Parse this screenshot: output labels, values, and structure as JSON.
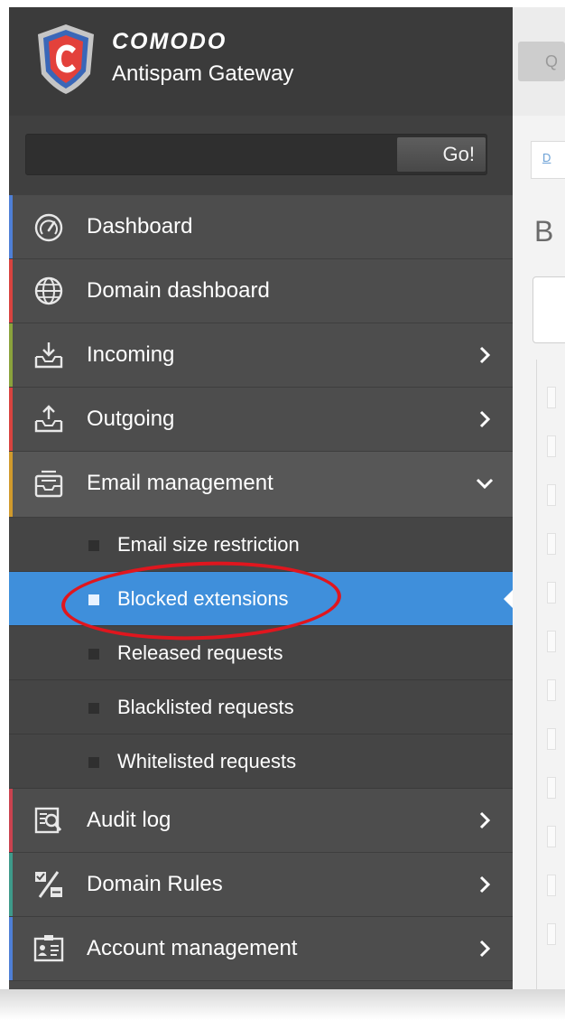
{
  "brand": {
    "name": "COMODO",
    "product": "Antispam Gateway"
  },
  "search": {
    "value": "",
    "button_label": "Go!"
  },
  "nav": {
    "dashboard": {
      "label": "Dashboard",
      "accent": "#4e7fd6"
    },
    "domain_dashboard": {
      "label": "Domain dashboard",
      "accent": "#d8433f"
    },
    "incoming": {
      "label": "Incoming",
      "accent": "#8aa23c"
    },
    "outgoing": {
      "label": "Outgoing",
      "accent": "#d8433f"
    },
    "email_management": {
      "label": "Email management",
      "accent": "#d09a2c",
      "expanded": true,
      "items": [
        {
          "label": "Email size restriction",
          "active": false
        },
        {
          "label": "Blocked extensions",
          "active": true
        },
        {
          "label": "Released requests",
          "active": false
        },
        {
          "label": "Blacklisted requests",
          "active": false
        },
        {
          "label": "Whitelisted requests",
          "active": false
        }
      ]
    },
    "audit_log": {
      "label": "Audit log",
      "accent": "#c9424f"
    },
    "domain_rules": {
      "label": "Domain Rules",
      "accent": "#3e9a8a"
    },
    "account_management": {
      "label": "Account management",
      "accent": "#4e7fd6"
    }
  },
  "main": {
    "top_button_text": "Q",
    "breadcrumb": "D",
    "page_title_letter": "B"
  },
  "icons": {
    "logo": "comodo-shield-logo",
    "dashboard": "gauge-icon",
    "domain_dashboard": "globe-icon",
    "incoming": "inbox-download-icon",
    "outgoing": "outbox-upload-icon",
    "email_management": "mail-tray-icon",
    "audit_log": "log-search-icon",
    "domain_rules": "rules-percent-icon",
    "account_management": "id-card-icon"
  },
  "colors": {
    "sidebar_bg": "#4a4a4a",
    "active_item": "#3f8fdb",
    "annotation": "#e0161e"
  }
}
